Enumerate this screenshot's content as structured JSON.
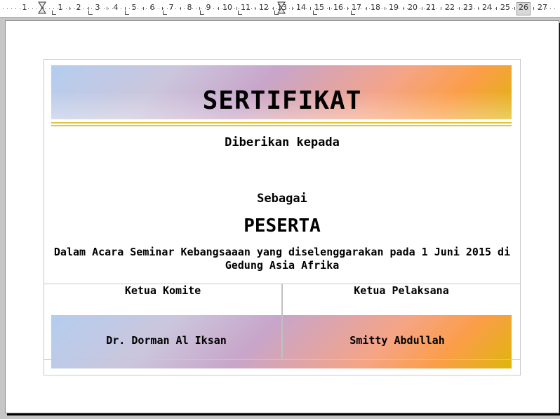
{
  "ruler": {
    "numbers": [
      "1",
      "1",
      "2",
      "3",
      "4",
      "5",
      "6",
      "7",
      "8",
      "9",
      "10",
      "11",
      "12",
      "13",
      "14",
      "15",
      "16",
      "17",
      "18",
      "19",
      "20",
      "21",
      "22",
      "23",
      "24",
      "25",
      "26",
      "27"
    ]
  },
  "certificate": {
    "title": "SERTIFIKAT",
    "given_to": "Diberikan kepada",
    "as_label": "Sebagai",
    "role": "PESERTA",
    "event_text": "Dalam Acara Seminar Kebangsaaan yang diselenggarakan pada 1 Juni 2015 di Gedung Asia Afrika",
    "signatures": {
      "left_title": "Ketua Komite",
      "right_title": "Ketua Pelaksana",
      "left_name": "Dr. Dorman Al Iksan",
      "right_name": "Smitty Abdullah"
    }
  },
  "colors": {
    "gradient": [
      "#b4cdef",
      "#c8a5ca",
      "#f5a487",
      "#fb9e47",
      "#deb50c"
    ],
    "rule": "#e2c43a"
  }
}
